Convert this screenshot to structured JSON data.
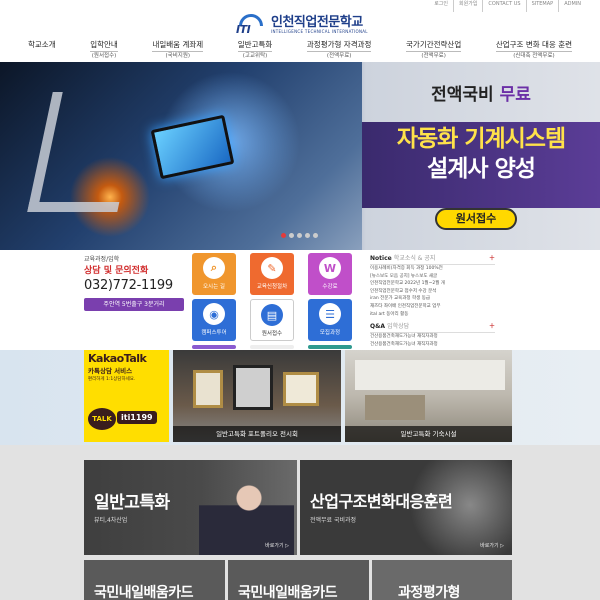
{
  "top_links": [
    "로그인",
    "회원가입",
    "CONTACT US",
    "SITEMAP",
    "ADMIN"
  ],
  "logo": {
    "mark": "ITI",
    "title": "인천직업전문학교",
    "subtitle": "INTELLIGENCE TECHNICAL INTERNATIONAL"
  },
  "nav": [
    {
      "label": "학교소개",
      "sub": ""
    },
    {
      "label": "입학안내",
      "sub": "(원서접수)"
    },
    {
      "label": "내일배움 계좌제",
      "sub": "(국비지원)"
    },
    {
      "label": "일반고특화",
      "sub": "(고교위탁)"
    },
    {
      "label": "과정평가형 자격과정",
      "sub": "(전액무료)"
    },
    {
      "label": "국가기간전략산업",
      "sub": "(전액무료)"
    },
    {
      "label": "산업구조 변화 대응 훈련",
      "sub": "(신대축 전액무료)"
    }
  ],
  "hero": {
    "line1_a": "전액국비",
    "line1_b": "무료",
    "line2": "자동화 기계시스템",
    "line3": "설계사 양성",
    "apply": "원서접수",
    "slides": 5,
    "active_slide": 1
  },
  "contact": {
    "small": "교육과정/입학",
    "title": "상담 및 문의전화",
    "phone": "032)772-1199",
    "address": "주안역 5번출구 3분거리"
  },
  "quick_buttons": [
    {
      "label": "오시는 길",
      "icon": "search-icon",
      "icon_glyph": "⌕",
      "color": "#f0962d"
    },
    {
      "label": "교육신청절차",
      "icon": "pen-icon",
      "icon_glyph": "✎",
      "color": "#ef6a2f"
    },
    {
      "label": "수강료",
      "icon": "won-icon",
      "icon_glyph": "W",
      "color": "#c04fc9"
    },
    {
      "label": "캠퍼스투어",
      "icon": "camera-icon",
      "icon_glyph": "◉",
      "color": "#2e6ed6"
    },
    {
      "label": "원서접수",
      "icon": "document-icon",
      "icon_glyph": "▤",
      "color": "#ffffff"
    },
    {
      "label": "모집과정",
      "icon": "list-icon",
      "icon_glyph": "☰",
      "color": "#2e6ed6"
    }
  ],
  "notice": {
    "title": "Notice",
    "subtitle": "학교소식 & 공지",
    "items": [
      "이용사례비(자격증 회득 과정 100%전",
      "[뉴스보도 모음 공지] 뉴스보도 새글",
      "인천직업전문학교 2022년 1월~2월 개",
      "인천직업전문학교 점수저 수강 분석",
      "iran 전문가 교육과정 학생 동급",
      "재즈타 좌이배 인천직업전문학교 업무",
      "ital art 동아리 활동"
    ],
    "qa_title": "Q&A",
    "qa_subtitle": "입학상담",
    "qa_items": [
      "건산용품건축재도가능녀 재직자과정",
      "건산용품건축재도가능녀 재직자과정"
    ]
  },
  "kakao": {
    "title": "KakaoTalk",
    "subtitle": "카톡상담 서비스",
    "small": "편리하게 1:1상담하세요.",
    "talk": "TALK",
    "id": "iti1199"
  },
  "gallery": [
    {
      "caption": "일반고특화 포트폴리오 전시회"
    },
    {
      "caption": "일반고특화 기숙시설"
    }
  ],
  "cards": [
    {
      "title": "일반고특화",
      "sub": "뷰티,4차산업",
      "more": "바로가기 ▷"
    },
    {
      "title": "산업구조변화대응훈련",
      "sub": "전액무료 국비과정",
      "more": "바로가기 ▷"
    }
  ],
  "bottom_cards": [
    {
      "title": "국민내일배움카드"
    },
    {
      "title": "국민내일배움카드"
    },
    {
      "title": "과정평가형"
    }
  ]
}
